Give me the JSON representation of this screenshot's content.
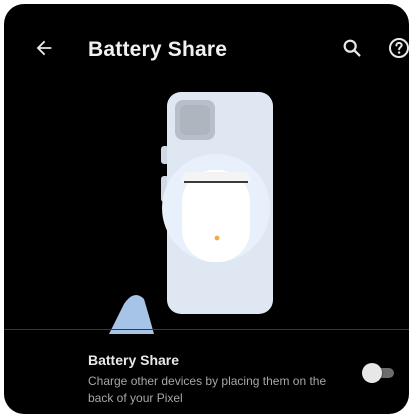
{
  "header": {
    "title": "Battery Share",
    "icons": {
      "back": "arrow-back-icon",
      "search": "search-icon",
      "help": "help-icon"
    }
  },
  "illustration": {
    "description_icon": "phone-sharing-battery-illustration"
  },
  "setting": {
    "title": "Battery Share",
    "summary": "Charge other devices by placing them on the back of your Pixel",
    "toggle_state": "off"
  },
  "colors": {
    "background": "#000000",
    "phone": "#dfe7f2",
    "accent_hand": "#a6c3e8",
    "toggle_track": "#6c6c6c",
    "toggle_thumb": "#e7e7e7"
  }
}
